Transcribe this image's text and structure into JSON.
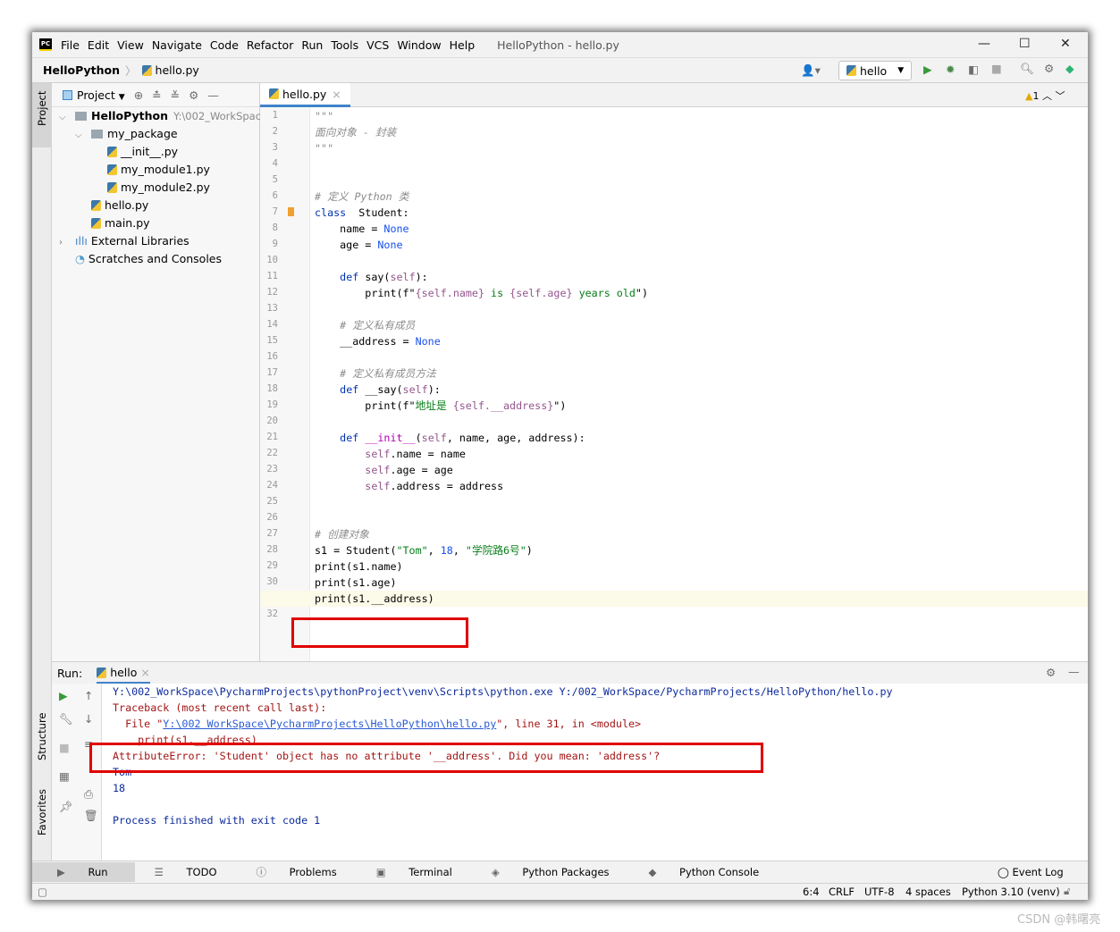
{
  "title_bar": {
    "logo": "PC",
    "menu": [
      "File",
      "Edit",
      "View",
      "Navigate",
      "Code",
      "Refactor",
      "Run",
      "Tools",
      "VCS",
      "Window",
      "Help"
    ],
    "window_title": "HelloPython - hello.py"
  },
  "nav": {
    "project": "HelloPython",
    "file": "hello.py",
    "run_config": "hello"
  },
  "left_stripe": {
    "project": "Project",
    "structure": "Structure",
    "favorites": "Favorites"
  },
  "project_panel": {
    "header": "Project",
    "tree": [
      {
        "label": "HelloPython",
        "extra": "Y:\\002_WorkSpace",
        "level": 0,
        "type": "folder",
        "arrow": "v",
        "bold": true
      },
      {
        "label": "my_package",
        "level": 1,
        "type": "folder",
        "arrow": "v"
      },
      {
        "label": "__init__.py",
        "level": 2,
        "type": "py"
      },
      {
        "label": "my_module1.py",
        "level": 2,
        "type": "py"
      },
      {
        "label": "my_module2.py",
        "level": 2,
        "type": "py"
      },
      {
        "label": "hello.py",
        "level": 1,
        "type": "py"
      },
      {
        "label": "main.py",
        "level": 1,
        "type": "py"
      },
      {
        "label": "External Libraries",
        "level": 0,
        "type": "lib",
        "arrow": ">"
      },
      {
        "label": "Scratches and Consoles",
        "level": 0,
        "type": "scratch"
      }
    ]
  },
  "editor": {
    "tab": "hello.py",
    "warnings": "1",
    "current_line": 31,
    "lines": [
      [
        [
          "cm",
          "\"\"\""
        ]
      ],
      [
        [
          "cm",
          "面向对象 - 封装"
        ]
      ],
      [
        [
          "cm",
          "\"\"\""
        ]
      ],
      [],
      [],
      [
        [
          "cm",
          "# 定义 Python 类"
        ]
      ],
      [
        [
          "kw",
          "class"
        ],
        [
          "",
          "  Student:"
        ]
      ],
      [
        [
          "",
          "    name = "
        ],
        [
          "nn",
          "None"
        ]
      ],
      [
        [
          "",
          "    age = "
        ],
        [
          "nn",
          "None"
        ]
      ],
      [],
      [
        [
          "",
          "    "
        ],
        [
          "kw",
          "def"
        ],
        [
          "",
          " say("
        ],
        [
          "sf",
          "self"
        ],
        [
          "",
          "):"
        ]
      ],
      [
        [
          "",
          "        print(f\""
        ],
        [
          "sf",
          "{self.name}"
        ],
        [
          "str",
          " is "
        ],
        [
          "sf",
          "{self.age}"
        ],
        [
          "str",
          " years old"
        ],
        [
          "",
          "\")"
        ]
      ],
      [],
      [
        [
          "cm",
          "    # 定义私有成员"
        ]
      ],
      [
        [
          "",
          "    __address = "
        ],
        [
          "nn",
          "None"
        ]
      ],
      [],
      [
        [
          "cm",
          "    # 定义私有成员方法"
        ]
      ],
      [
        [
          "",
          "    "
        ],
        [
          "kw",
          "def"
        ],
        [
          "",
          " __say("
        ],
        [
          "sf",
          "self"
        ],
        [
          "",
          "):"
        ]
      ],
      [
        [
          "",
          "        print(f\""
        ],
        [
          "str",
          "地址是 "
        ],
        [
          "sf",
          "{self.__address}"
        ],
        [
          "",
          "\")"
        ]
      ],
      [],
      [
        [
          "",
          "    "
        ],
        [
          "kw",
          "def"
        ],
        [
          "mg",
          " __init__"
        ],
        [
          "",
          "("
        ],
        [
          "sf",
          "self"
        ],
        [
          "",
          ", name, age, address):"
        ]
      ],
      [
        [
          "",
          "        "
        ],
        [
          "sf",
          "self"
        ],
        [
          "",
          ".name = name"
        ]
      ],
      [
        [
          "",
          "        "
        ],
        [
          "sf",
          "self"
        ],
        [
          "",
          ".age = age"
        ]
      ],
      [
        [
          "",
          "        "
        ],
        [
          "sf",
          "self"
        ],
        [
          "",
          ".address = address"
        ]
      ],
      [],
      [],
      [
        [
          "cm",
          "# 创建对象"
        ]
      ],
      [
        [
          "",
          "s1 = Student("
        ],
        [
          "str",
          "\"Tom\""
        ],
        [
          "",
          ", "
        ],
        [
          "nn",
          "18"
        ],
        [
          "",
          ", "
        ],
        [
          "str",
          "\"学院路6号\""
        ],
        [
          "",
          ")"
        ]
      ],
      [
        [
          "",
          "print(s1.name)"
        ]
      ],
      [
        [
          "",
          "print(s1.age)"
        ]
      ],
      [
        [
          "",
          "print(s1.__address)"
        ]
      ],
      []
    ]
  },
  "run_panel": {
    "label": "Run:",
    "tab": "hello",
    "output": [
      {
        "cls": "cmd",
        "text": "Y:\\002_WorkSpace\\PycharmProjects\\pythonProject\\venv\\Scripts\\python.exe Y:/002_WorkSpace/PycharmProjects/HelloPython/hello.py"
      },
      {
        "cls": "err",
        "text": "Traceback (most recent call last):"
      },
      {
        "cls": "err",
        "text": "  File \"",
        "link": "Y:\\002 WorkSpace\\PycharmProjects\\HelloPython\\hello.py",
        "after": "\", line 31, in <module>"
      },
      {
        "cls": "err",
        "text": "    print(s1.__address)"
      },
      {
        "cls": "err",
        "text": "AttributeError: 'Student' object has no attribute '__address'. Did you mean: 'address'?"
      },
      {
        "cls": "std",
        "text": "Tom"
      },
      {
        "cls": "std",
        "text": "18"
      },
      {
        "cls": "std",
        "text": ""
      },
      {
        "cls": "cmd",
        "text": "Process finished with exit code 1"
      }
    ]
  },
  "bottom_tabs": [
    "Run",
    "TODO",
    "Problems",
    "Terminal",
    "Python Packages",
    "Python Console"
  ],
  "event_log": "Event Log",
  "status_bar": {
    "position": "6:4",
    "line_sep": "CRLF",
    "encoding": "UTF-8",
    "indent": "4 spaces",
    "interpreter": "Python 3.10 (venv)"
  },
  "watermark": "CSDN @韩曙亮",
  "colors": {
    "keyword": "#0033b3",
    "string": "#067d17",
    "comment": "#8c8c8c",
    "self": "#94558d",
    "error": "#a31515",
    "cmd": "#0c2a9c",
    "highlight_box": "#e00000"
  }
}
